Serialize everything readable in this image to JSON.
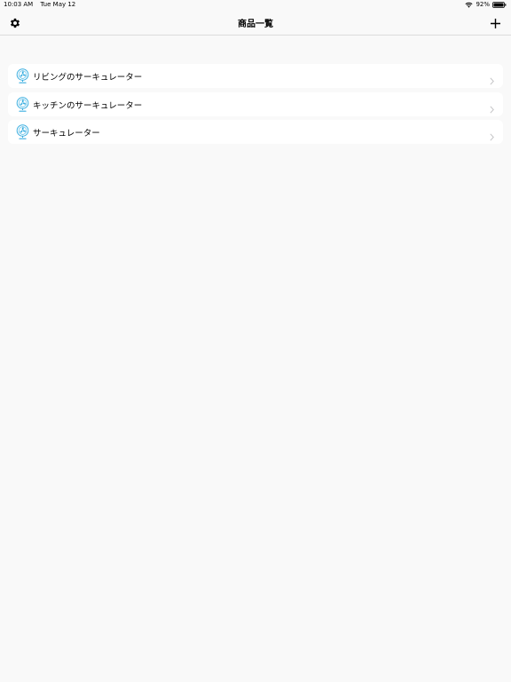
{
  "status_bar": {
    "time": "10:03 AM",
    "date": "Tue May 12",
    "battery": "92%"
  },
  "nav": {
    "title": "商品一覧"
  },
  "products": [
    {
      "label": "リビングのサーキュレーター",
      "icon": "fan-icon"
    },
    {
      "label": "キッチンのサーキュレーター",
      "icon": "fan-icon"
    },
    {
      "label": "サーキュレーター",
      "icon": "fan-icon"
    }
  ],
  "colors": {
    "accent": "#3aaee0",
    "background": "#f9f9f9",
    "row": "#ffffff"
  }
}
